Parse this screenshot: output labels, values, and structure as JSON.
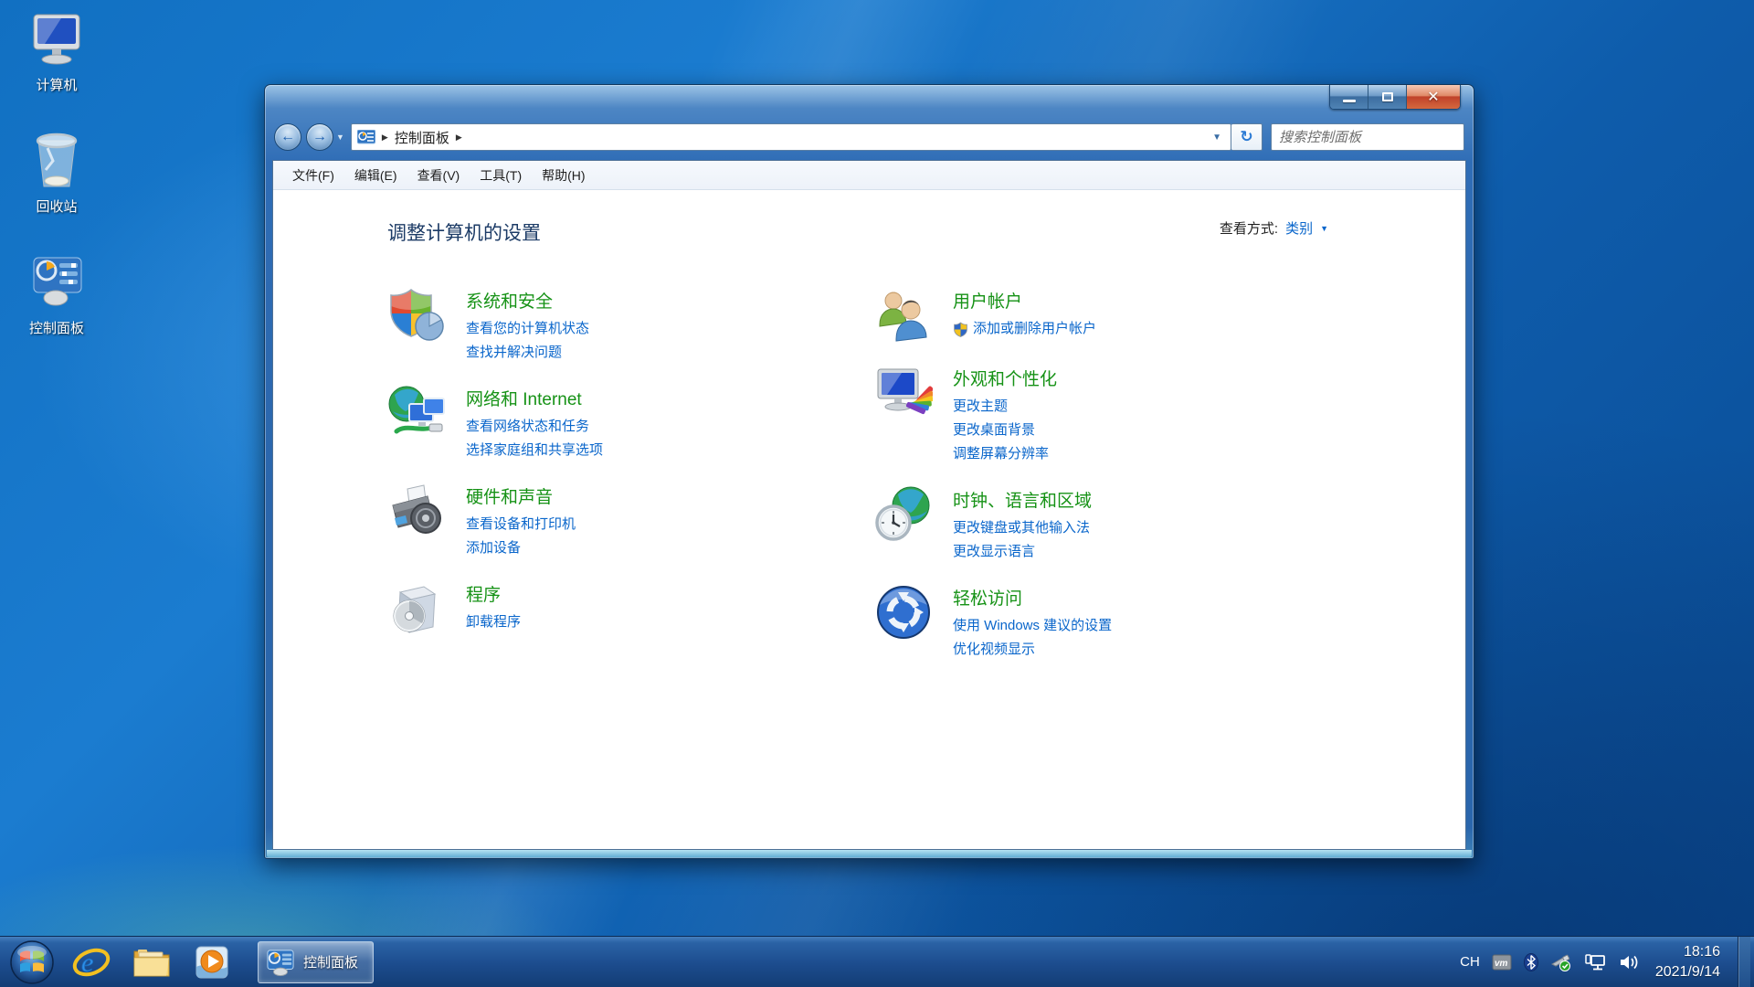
{
  "desktop": {
    "icons": [
      {
        "name": "computer",
        "label": "计算机"
      },
      {
        "name": "recycle-bin",
        "label": "回收站"
      },
      {
        "name": "control-panel",
        "label": "控制面板"
      }
    ]
  },
  "window": {
    "controls": {
      "minimize": "minimize",
      "maximize": "maximize",
      "close": "close"
    },
    "nav": {
      "breadcrumb_root": "控制面板",
      "search_placeholder": "搜索控制面板"
    },
    "menubar": {
      "items": [
        {
          "label": "文件(F)"
        },
        {
          "label": "编辑(E)"
        },
        {
          "label": "查看(V)"
        },
        {
          "label": "工具(T)"
        },
        {
          "label": "帮助(H)"
        }
      ]
    },
    "header": {
      "title": "调整计算机的设置",
      "view_by_label": "查看方式:",
      "view_by_value": "类别"
    },
    "categories": [
      {
        "icon": "security-shield-icon",
        "title": "系统和安全",
        "links": [
          "查看您的计算机状态",
          "查找并解决问题"
        ]
      },
      {
        "icon": "network-internet-icon",
        "title": "网络和 Internet",
        "links": [
          "查看网络状态和任务",
          "选择家庭组和共享选项"
        ]
      },
      {
        "icon": "hardware-sound-icon",
        "title": "硬件和声音",
        "links": [
          "查看设备和打印机",
          "添加设备"
        ]
      },
      {
        "icon": "programs-icon",
        "title": "程序",
        "links": [
          "卸载程序"
        ]
      },
      {
        "icon": "user-accounts-icon",
        "title": "用户帐户",
        "links": [
          "添加或删除用户帐户"
        ],
        "first_link_has_uac_shield": true
      },
      {
        "icon": "appearance-personalization-icon",
        "title": "外观和个性化",
        "links": [
          "更改主题",
          "更改桌面背景",
          "调整屏幕分辨率"
        ]
      },
      {
        "icon": "clock-language-region-icon",
        "title": "时钟、语言和区域",
        "links": [
          "更改键盘或其他输入法",
          "更改显示语言"
        ]
      },
      {
        "icon": "ease-of-access-icon",
        "title": "轻松访问",
        "links": [
          "使用 Windows 建议的设置",
          "优化视频显示"
        ]
      }
    ]
  },
  "taskbar": {
    "apps": [
      {
        "icon": "start-orb-icon"
      },
      {
        "icon": "internet-explorer-icon"
      },
      {
        "icon": "explorer-folder-icon"
      },
      {
        "icon": "media-player-icon"
      }
    ],
    "active_task": {
      "icon": "control-panel-icon",
      "label": "控制面板"
    },
    "tray": {
      "language": "CH",
      "icons": [
        "vmware-icon",
        "bluetooth-icon",
        "usb-safely-remove-icon",
        "network-icon",
        "volume-icon"
      ],
      "time": "18:16",
      "date": "2021/9/14"
    }
  },
  "colors": {
    "category_title_green": "#169216",
    "link_blue": "#0a66cb",
    "heading_navy": "#1c3b66",
    "close_button_red": "#c0422a",
    "desktop_blue": "#1170c2"
  }
}
